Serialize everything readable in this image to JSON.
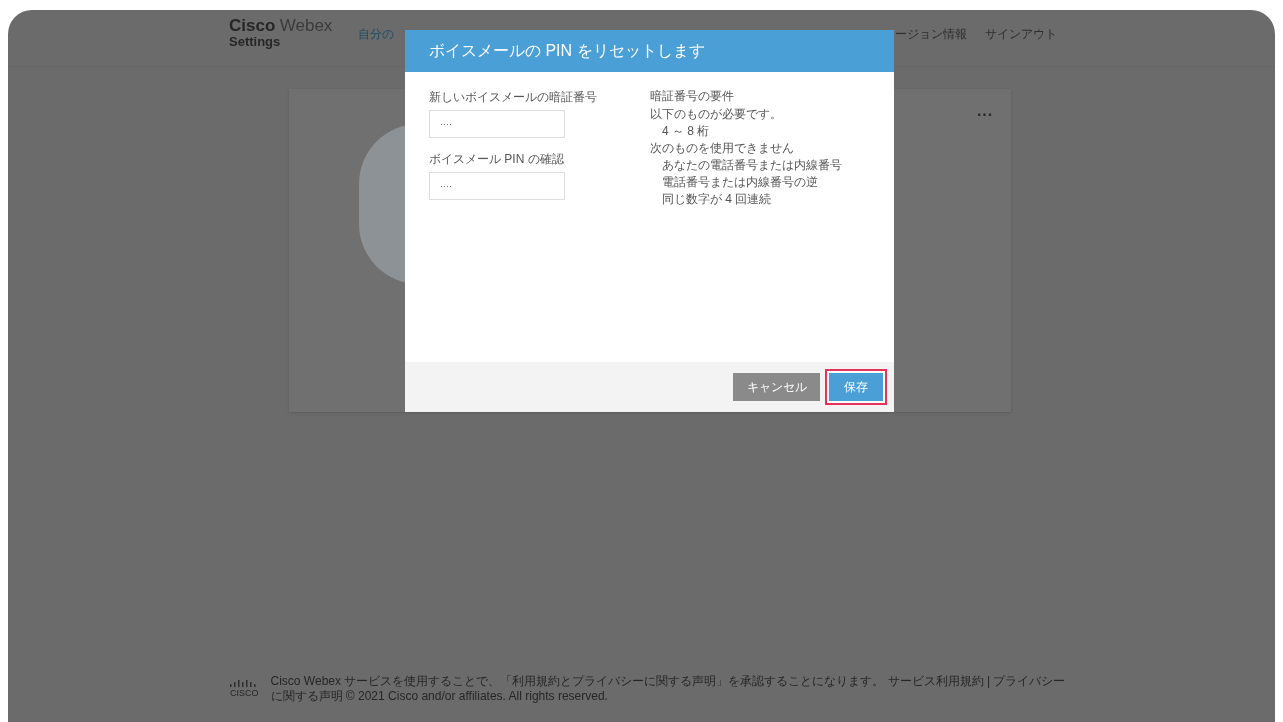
{
  "header": {
    "brand": "Cisco",
    "product": "Webex",
    "subtitle": "Settings",
    "nav": [
      {
        "label": "自分の",
        "kind": "link"
      },
      {
        "label": "ージョン情報",
        "kind": "plain"
      },
      {
        "label": "サインアウト",
        "kind": "plain"
      }
    ]
  },
  "card": {
    "menu": "···"
  },
  "dialog": {
    "title": "ボイスメールの PIN をリセットします",
    "fields": [
      {
        "label": "新しいボイスメールの暗証番号",
        "value": "····"
      },
      {
        "label": "ボイスメール PIN の確認",
        "value": "····"
      }
    ],
    "requirements": {
      "title": "暗証番号の要件",
      "items": [
        {
          "text": "以下のものが必要です。",
          "children": [
            {
              "text": "4 ～ 8 桁"
            }
          ]
        },
        {
          "text": "次のものを使用できません",
          "children": [
            {
              "text": "あなたの電話番号または内線番号"
            },
            {
              "text": "電話番号または内線番号の逆"
            },
            {
              "text": "同じ数字が 4 回連続"
            }
          ]
        }
      ]
    },
    "buttons": [
      {
        "label": "キャンセル",
        "kind": "secondary",
        "highlighted": false
      },
      {
        "label": "保存",
        "kind": "primary",
        "highlighted": true
      }
    ]
  },
  "footer": {
    "logo": "CISCO",
    "text": "Cisco Webex サービスを使用することで、「利用規約とプライバシーに関する声明」を承認することになります。 サービス利用規約 | プライバシーに関する声明 © 2021 Cisco and/or affiliates. All rights reserved."
  }
}
